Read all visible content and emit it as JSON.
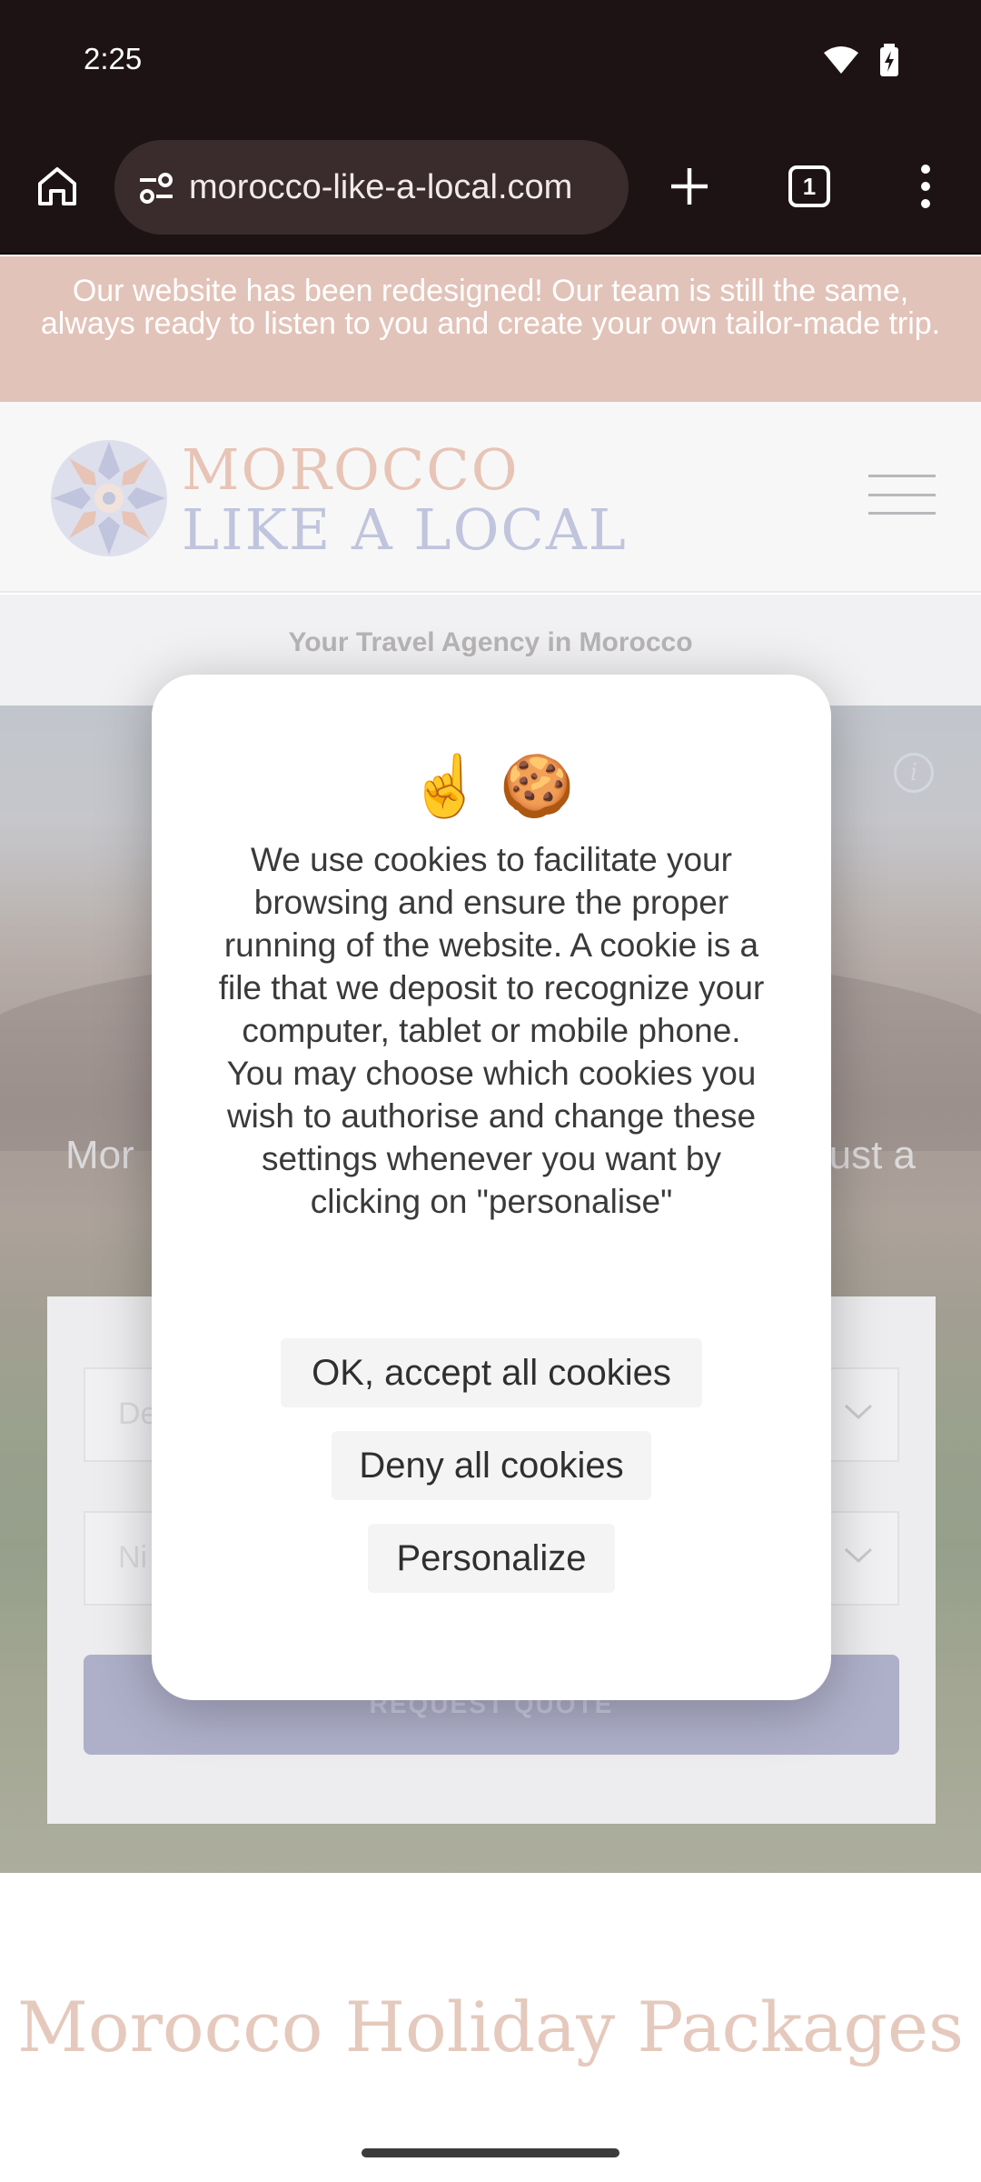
{
  "status_bar": {
    "time": "2:25",
    "icons": [
      "wifi-icon",
      "battery-charging-icon"
    ]
  },
  "browser": {
    "url": "morocco-like-a-local.com",
    "tab_count": "1",
    "icons": [
      "home-icon",
      "site-settings-icon",
      "new-tab-icon",
      "tabs-icon",
      "more-menu-icon"
    ]
  },
  "site": {
    "announcement": "Our website has been redesigned! Our team is still the same, always ready to listen to you and create your own tailor-made trip.",
    "logo": {
      "line1": "MOROCCO",
      "line2": "LIKE A LOCAL"
    },
    "tagline": "Your Travel Agency in Morocco",
    "hero": {
      "text_left": "Mor",
      "text_right": "ust a"
    },
    "quote_form": {
      "select1_placeholder": "De",
      "select2_placeholder": "Ni",
      "request_button": "REQUEST QUOTE"
    },
    "section_title": "Morocco Holiday Packages"
  },
  "cookie_dialog": {
    "emojis": "☝️ 🍪",
    "message": "We use cookies to facilitate your browsing and ensure the proper running of the website. A cookie is a file that we deposit to recognize your computer, tablet or mobile phone. You may choose which cookies you wish to authorise and change these settings whenever you want by clicking on \"personalise\"",
    "accept_label": "OK, accept all cookies",
    "deny_label": "Deny all cookies",
    "personalize_label": "Personalize"
  },
  "colors": {
    "chrome_bg": "#1e1314",
    "announcement_bg": "#d19e8f",
    "logo_primary": "#d9a089",
    "logo_secondary": "#9aa1c8",
    "button_purple": "#7d7ea8",
    "section_title": "#d6a895"
  }
}
